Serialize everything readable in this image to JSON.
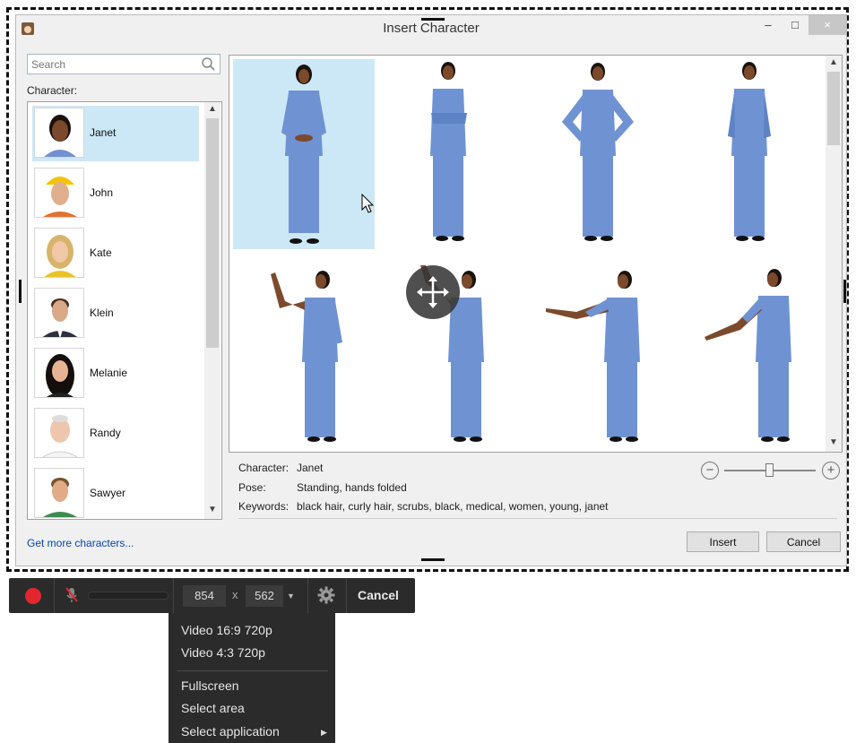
{
  "dialog": {
    "title": "Insert Character",
    "search_placeholder": "Search",
    "character_label": "Character:",
    "characters": [
      {
        "name": "Janet",
        "selected": true
      },
      {
        "name": "John"
      },
      {
        "name": "Kate"
      },
      {
        "name": "Klein"
      },
      {
        "name": "Melanie"
      },
      {
        "name": "Randy"
      },
      {
        "name": "Sawyer"
      }
    ],
    "details": {
      "character_key": "Character:",
      "character_value": "Janet",
      "pose_key": "Pose:",
      "pose_value": "Standing, hands folded",
      "keywords_key": "Keywords:",
      "keywords_value": "black hair, curly hair, scrubs, black, medical, women, young, janet"
    },
    "more_link": "Get more characters...",
    "insert_label": "Insert",
    "cancel_label": "Cancel",
    "zoom_minus": "−",
    "zoom_plus": "+",
    "min_glyph": "–",
    "max_glyph": "□",
    "close_glyph": "×"
  },
  "recorder": {
    "width": "854",
    "height": "562",
    "x_sep": "x",
    "cancel_label": "Cancel",
    "menu": {
      "video_169": "Video 16:9 720p",
      "video_43": "Video 4:3 720p",
      "fullscreen": "Fullscreen",
      "select_area": "Select area",
      "select_app": "Select application"
    }
  },
  "colors": {
    "selection": "#cce8f7",
    "scrubs": "#6f93d2",
    "record": "#e3262d",
    "link": "#0645ad"
  }
}
